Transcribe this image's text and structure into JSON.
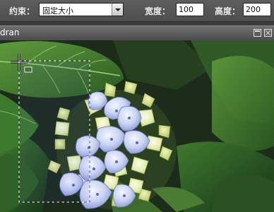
{
  "options_bar": {
    "constraint_label": "约束：",
    "constraint_value": "固定大小",
    "width_label": "宽度：",
    "width_value": "100",
    "height_label": "高度：",
    "height_value": "200"
  },
  "document": {
    "title": "dran"
  },
  "icons": {
    "crosshair": "crosshair-cursor-icon",
    "marquee": "marquee-tool-icon",
    "maximize": "maximize-icon",
    "close": "close-icon"
  }
}
